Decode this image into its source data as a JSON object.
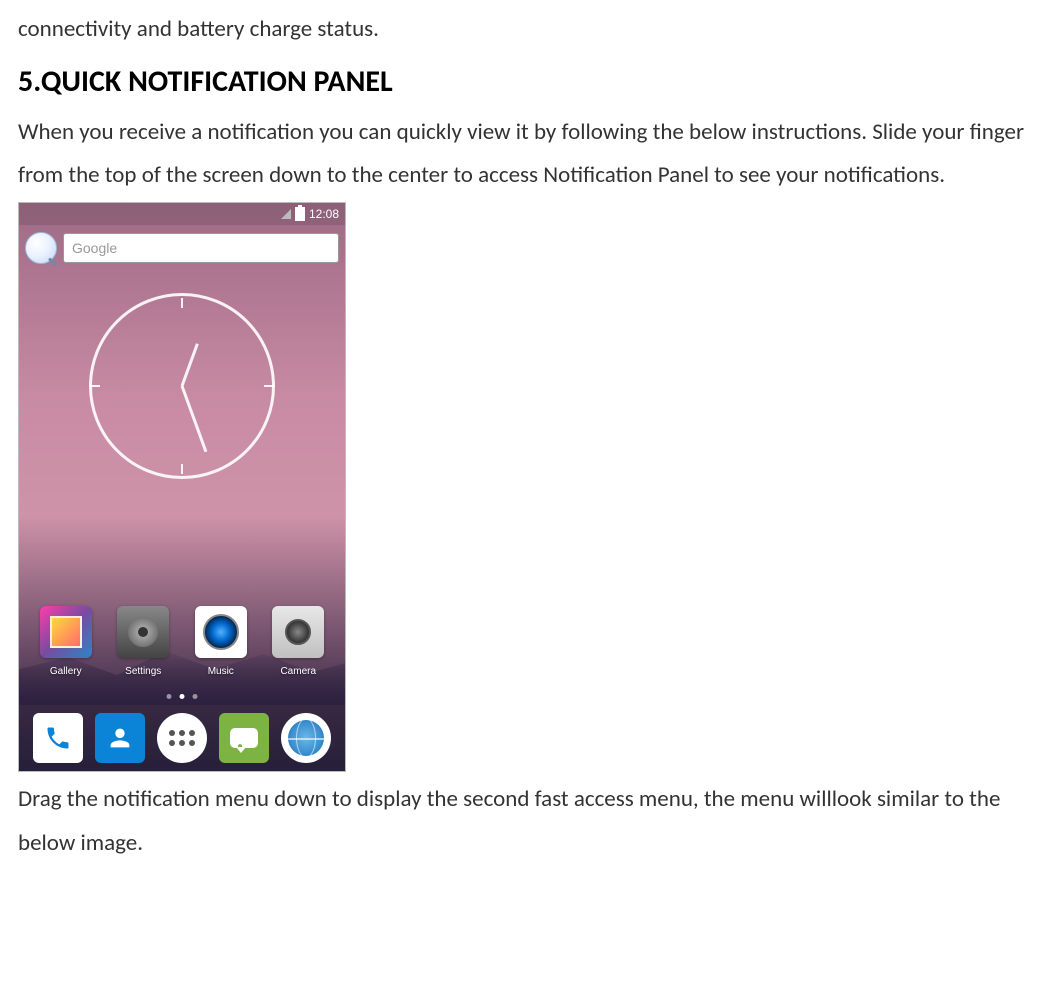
{
  "intro_line": "connectivity and battery charge status.",
  "heading": "5.QUICK NOTIFICATION PANEL",
  "para1": "When you receive a notification you can quickly view it by following the below instructions. Slide your finger from the top of the screen down to the center to access Notification Panel to see your notifications.",
  "para2": "Drag the notification menu down to display the second fast access menu, the menu willlook similar to the below image.",
  "phone": {
    "status_time": "12:08",
    "search_placeholder": "Google",
    "apps": [
      {
        "label": "Gallery"
      },
      {
        "label": "Settings"
      },
      {
        "label": "Music"
      },
      {
        "label": "Camera"
      }
    ]
  }
}
